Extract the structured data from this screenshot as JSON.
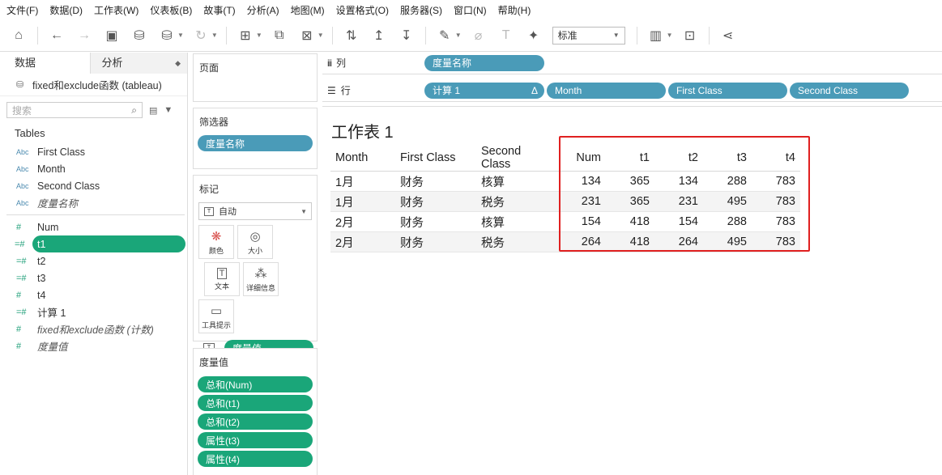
{
  "menu": [
    "文件(F)",
    "数据(D)",
    "工作表(W)",
    "仪表板(B)",
    "故事(T)",
    "分析(A)",
    "地图(M)",
    "设置格式(O)",
    "服务器(S)",
    "窗口(N)",
    "帮助(H)"
  ],
  "toolbar": {
    "fit_select": "标准"
  },
  "left_pane": {
    "tab_data": "数据",
    "tab_analysis": "分析",
    "datasource": "fixed和exclude函数 (tableau)",
    "search_placeholder": "搜索",
    "tables_header": "Tables",
    "dimensions": [
      {
        "type": "Abc",
        "name": "First Class",
        "italic": false
      },
      {
        "type": "Abc",
        "name": "Month",
        "italic": false
      },
      {
        "type": "Abc",
        "name": "Second Class",
        "italic": false
      },
      {
        "type": "Abc",
        "name": "度量名称",
        "italic": true
      }
    ],
    "measures": [
      {
        "type": "#",
        "name": "Num",
        "italic": false,
        "selected": false
      },
      {
        "type": "=#",
        "name": "t1",
        "italic": false,
        "selected": true
      },
      {
        "type": "=#",
        "name": "t2",
        "italic": false,
        "selected": false
      },
      {
        "type": "=#",
        "name": "t3",
        "italic": false,
        "selected": false
      },
      {
        "type": "#",
        "name": "t4",
        "italic": false,
        "selected": false
      },
      {
        "type": "=#",
        "name": "计算 1",
        "italic": false,
        "selected": false
      },
      {
        "type": "#",
        "name": "fixed和exclude函数 (计数)",
        "italic": true,
        "selected": false
      },
      {
        "type": "#",
        "name": "度量值",
        "italic": true,
        "selected": false
      }
    ]
  },
  "pages": {
    "label": "页面"
  },
  "filters": {
    "label": "筛选器",
    "pills": [
      "度量名称"
    ]
  },
  "marks": {
    "label": "标记",
    "type": "自动",
    "buttons": [
      "颜色",
      "大小",
      "文本",
      "详细信息",
      "工具提示"
    ],
    "text_pill": "度量值"
  },
  "measure_values": {
    "label": "度量值",
    "pills": [
      "总和(Num)",
      "总和(t1)",
      "总和(t2)",
      "属性(t3)",
      "属性(t4)"
    ]
  },
  "columns_shelf": {
    "label": "列",
    "pills": [
      "度量名称"
    ]
  },
  "rows_shelf": {
    "label": "行",
    "pills": [
      "计算 1",
      "Month",
      "First Class",
      "Second Class"
    ],
    "delta": "Δ"
  },
  "sheet": {
    "title": "工作表 1",
    "headers": [
      "Month",
      "First Class",
      "Second Class",
      "Num",
      "t1",
      "t2",
      "t3",
      "t4"
    ],
    "rows": [
      [
        "1月",
        "财务",
        "核算",
        "134",
        "365",
        "134",
        "288",
        "783"
      ],
      [
        "1月",
        "财务",
        "税务",
        "231",
        "365",
        "231",
        "495",
        "783"
      ],
      [
        "2月",
        "财务",
        "核算",
        "154",
        "418",
        "154",
        "288",
        "783"
      ],
      [
        "2月",
        "财务",
        "税务",
        "264",
        "418",
        "264",
        "495",
        "783"
      ]
    ],
    "highlight_color": "#e02020"
  }
}
